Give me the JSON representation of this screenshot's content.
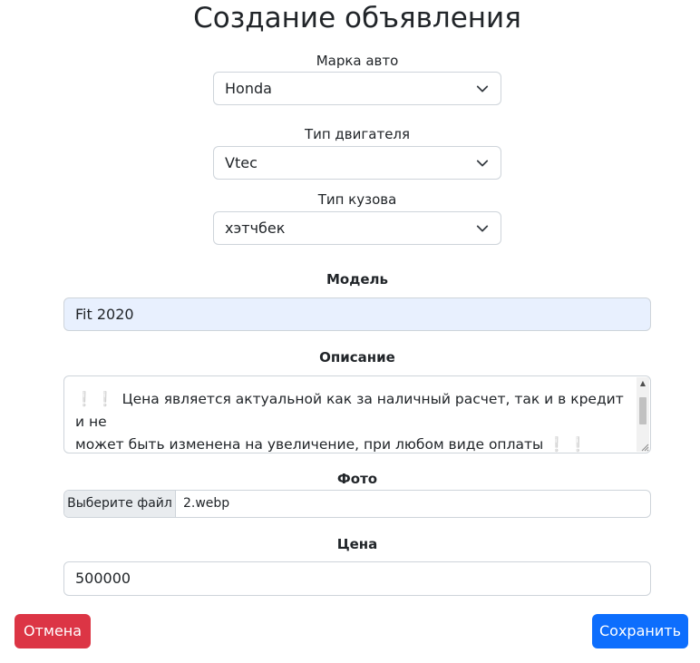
{
  "page": {
    "title": "Создание объявления"
  },
  "form": {
    "brand": {
      "label": "Марка авто",
      "value": "Honda"
    },
    "engine": {
      "label": "Тип двигателя",
      "value": "Vtec"
    },
    "body": {
      "label": "Тип кузова",
      "value": "хэтчбек"
    },
    "model": {
      "label": "Модель",
      "value": "Fit 2020"
    },
    "description": {
      "label": "Описание",
      "line1": "Цена является актуальной как за наличный расчет, так и в кредит и не",
      "line2": "может быть изменена на увеличение, при любом виде оплаты",
      "emoji": "❕"
    },
    "photo": {
      "label": "Фото",
      "button": "Выберите файл",
      "filename": "2.webp"
    },
    "price": {
      "label": "Цена",
      "value": "500000"
    }
  },
  "actions": {
    "cancel_label": "Отмена",
    "save_label": "Сохранить"
  },
  "colors": {
    "danger": "#dc3545",
    "primary": "#0d6efd",
    "autofill": "#e8f0fe",
    "border": "#ced4da"
  },
  "icons": {
    "select_arrow": "chevron-down-icon",
    "textarea_resize": "resize-grip-icon"
  }
}
